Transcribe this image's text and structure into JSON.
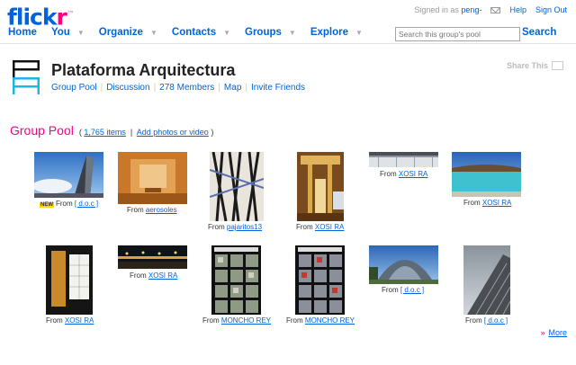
{
  "header": {
    "logo_main": "flick",
    "logo_accent": "r",
    "logo_tm": "™",
    "signed_in_text": "Signed in as",
    "username": "peng-",
    "help": "Help",
    "signout": "Sign Out"
  },
  "nav": {
    "items": [
      "Home",
      "You",
      "Organize",
      "Contacts",
      "Groups",
      "Explore"
    ],
    "search_placeholder": "Search this group's pool",
    "search_label": "Search"
  },
  "group": {
    "title": "Plataforma Arquitectura",
    "links": [
      "Group Pool",
      "Discussion",
      "278 Members",
      "Map",
      "Invite Friends"
    ],
    "share_label": "Share This"
  },
  "pool": {
    "heading": "Group Pool",
    "open_paren": "(",
    "items_count": "1,765 items",
    "separator": "|",
    "add_link": "Add photos or video",
    "close_paren": ")",
    "from_label": "From",
    "new_badge": "NEW",
    "photos": [
      {
        "owner": "[ d.o.c ]",
        "is_new": true
      },
      {
        "owner": "aerosoles"
      },
      {
        "owner": "pajaritos13"
      },
      {
        "owner": "XOSI RA"
      },
      {
        "owner": "XOSI RA"
      },
      {
        "owner": "XOSI RA"
      },
      {
        "owner": "XOSI RA"
      },
      {
        "owner": "XOSI RA"
      },
      {
        "owner": "MONCHO REY"
      },
      {
        "owner": "MONCHO REY"
      },
      {
        "owner": "[ d.o.c ]"
      },
      {
        "owner": "[ d.o.c ]"
      }
    ],
    "more": "More"
  },
  "colors": {
    "accent_blue": "#0063dc",
    "accent_pink": "#ff0084"
  }
}
